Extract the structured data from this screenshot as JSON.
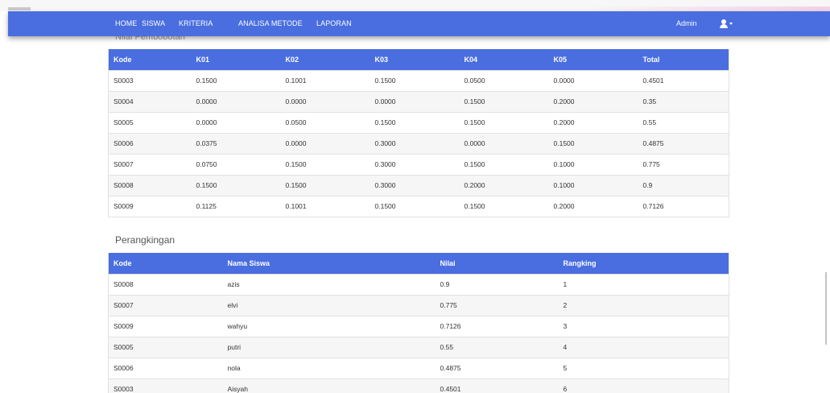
{
  "nav": {
    "items": [
      "HOME",
      "SISWA",
      "KRITERIA",
      "ANALISA METODE",
      "LAPORAN"
    ],
    "user_label": "Admin",
    "accent": "#4a6ee0"
  },
  "section_top": {
    "title": "Nilai Pembobotan"
  },
  "table1": {
    "headers": [
      "Kode",
      "K01",
      "K02",
      "K03",
      "K04",
      "K05",
      "Total"
    ],
    "rows": [
      [
        "S0003",
        "0.1500",
        "0.1001",
        "0.1500",
        "0.0500",
        "0.0000",
        "0.4501"
      ],
      [
        "S0004",
        "0.0000",
        "0.0000",
        "0.0000",
        "0.1500",
        "0.2000",
        "0.35"
      ],
      [
        "S0005",
        "0.0000",
        "0.0500",
        "0.1500",
        "0.1500",
        "0.2000",
        "0.55"
      ],
      [
        "S0006",
        "0.0375",
        "0.0000",
        "0.3000",
        "0.0000",
        "0.1500",
        "0.4875"
      ],
      [
        "S0007",
        "0.0750",
        "0.1500",
        "0.3000",
        "0.1500",
        "0.1000",
        "0.775"
      ],
      [
        "S0008",
        "0.1500",
        "0.1500",
        "0.3000",
        "0.2000",
        "0.1000",
        "0.9"
      ],
      [
        "S0009",
        "0.1125",
        "0.1001",
        "0.1500",
        "0.1500",
        "0.2000",
        "0.7126"
      ]
    ]
  },
  "section_rank": {
    "title": "Perangkingan"
  },
  "table2": {
    "headers": [
      "Kode",
      "Nama Siswa",
      "Nilai",
      "Rangking"
    ],
    "rows": [
      [
        "S0008",
        "azis",
        "0.9",
        "1"
      ],
      [
        "S0007",
        "elvi",
        "0.775",
        "2"
      ],
      [
        "S0009",
        "wahyu",
        "0.7126",
        "3"
      ],
      [
        "S0005",
        "putri",
        "0.55",
        "4"
      ],
      [
        "S0006",
        "nola",
        "0.4875",
        "5"
      ],
      [
        "S0003",
        "Aisyah",
        "0.4501",
        "6"
      ]
    ]
  }
}
